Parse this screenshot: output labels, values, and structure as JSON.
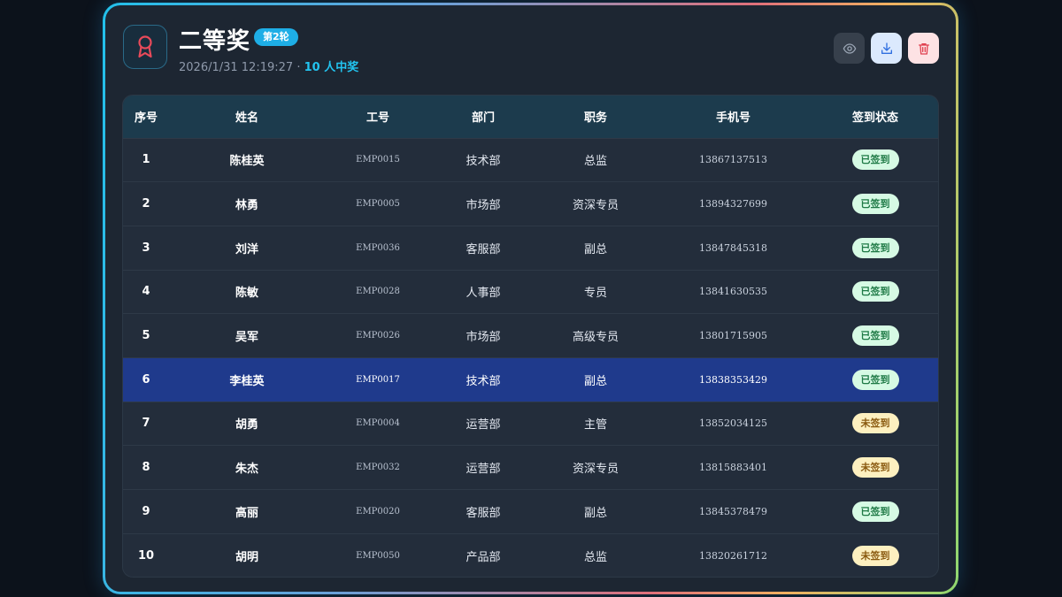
{
  "header": {
    "title": "二等奖",
    "round_badge": "第2轮",
    "timestamp": "2026/1/31 12:19:27",
    "separator": " · ",
    "winner_count": "10 人中奖",
    "icon": "award-ribbon-icon"
  },
  "actions": [
    {
      "name": "view",
      "icon": "eye-icon"
    },
    {
      "name": "download",
      "icon": "download-icon"
    },
    {
      "name": "delete",
      "icon": "trash-icon"
    }
  ],
  "table": {
    "headers": [
      "序号",
      "姓名",
      "工号",
      "部门",
      "职务",
      "手机号",
      "签到状态"
    ],
    "rows": [
      {
        "idx": "1",
        "name": "陈桂英",
        "emp": "EMP0015",
        "dept": "技术部",
        "role": "总监",
        "phone": "13867137513",
        "status": "已签到",
        "checked": true
      },
      {
        "idx": "2",
        "name": "林勇",
        "emp": "EMP0005",
        "dept": "市场部",
        "role": "资深专员",
        "phone": "13894327699",
        "status": "已签到",
        "checked": true
      },
      {
        "idx": "3",
        "name": "刘洋",
        "emp": "EMP0036",
        "dept": "客服部",
        "role": "副总",
        "phone": "13847845318",
        "status": "已签到",
        "checked": true
      },
      {
        "idx": "4",
        "name": "陈敏",
        "emp": "EMP0028",
        "dept": "人事部",
        "role": "专员",
        "phone": "13841630535",
        "status": "已签到",
        "checked": true
      },
      {
        "idx": "5",
        "name": "吴军",
        "emp": "EMP0026",
        "dept": "市场部",
        "role": "高级专员",
        "phone": "13801715905",
        "status": "已签到",
        "checked": true
      },
      {
        "idx": "6",
        "name": "李桂英",
        "emp": "EMP0017",
        "dept": "技术部",
        "role": "副总",
        "phone": "13838353429",
        "status": "已签到",
        "checked": true
      },
      {
        "idx": "7",
        "name": "胡勇",
        "emp": "EMP0004",
        "dept": "运营部",
        "role": "主管",
        "phone": "13852034125",
        "status": "未签到",
        "checked": false
      },
      {
        "idx": "8",
        "name": "朱杰",
        "emp": "EMP0032",
        "dept": "运营部",
        "role": "资深专员",
        "phone": "13815883401",
        "status": "未签到",
        "checked": false
      },
      {
        "idx": "9",
        "name": "高丽",
        "emp": "EMP0020",
        "dept": "客服部",
        "role": "副总",
        "phone": "13845378479",
        "status": "已签到",
        "checked": true
      },
      {
        "idx": "10",
        "name": "胡明",
        "emp": "EMP0050",
        "dept": "产品部",
        "role": "总监",
        "phone": "13820261712",
        "status": "未签到",
        "checked": false
      }
    ]
  },
  "colors": {
    "accent": "#22c4f0",
    "highlight_row": "#1f3a8c",
    "checked_bg": "#d6fae4",
    "unchecked_bg": "#fdf0c0"
  }
}
